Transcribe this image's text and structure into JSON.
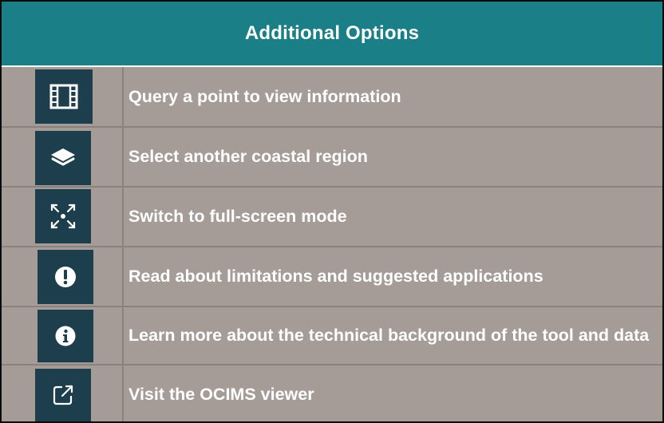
{
  "panel": {
    "title": "Additional Options"
  },
  "options": [
    {
      "label": "Query a point to view information",
      "icon": "film-icon"
    },
    {
      "label": "Select another coastal region",
      "icon": "layers-icon"
    },
    {
      "label": "Switch to full-screen mode",
      "icon": "fullscreen-icon"
    },
    {
      "label": "Read about limitations and suggested applications",
      "icon": "exclamation-circle-icon"
    },
    {
      "label": "Learn more about the technical background of the tool and data",
      "icon": "info-circle-icon"
    },
    {
      "label": "Visit the OCIMS viewer",
      "icon": "external-link-icon"
    }
  ],
  "colors": {
    "header": "#1a7f86",
    "panel_background": "#a59c97",
    "icon_box": "#1d3f4d",
    "text": "#ffffff"
  }
}
